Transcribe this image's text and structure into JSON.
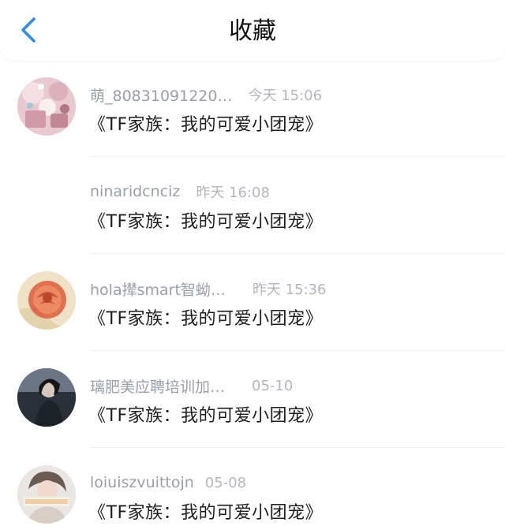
{
  "header": {
    "title": "收藏",
    "back_icon": "chevron-left-icon",
    "accent": "#2f8be8"
  },
  "items": [
    {
      "name": "萌_80831091220…",
      "time": "今天 15:06",
      "book": "《TF家族：我的可爱小团宠》",
      "avatar": "pink-floral-avatar"
    },
    {
      "name": "ninaridcnciz",
      "time": "昨天 16:08",
      "book": "《TF家族：我的可爱小团宠》",
      "avatar": ""
    },
    {
      "name": "hola撵smart智蚴…",
      "time": "昨天 15:36",
      "book": "《TF家族：我的可爱小团宠》",
      "avatar": "rose-avatar"
    },
    {
      "name": "璃肥美应聘培训加…",
      "time": "05-10",
      "book": "《TF家族：我的可爱小团宠》",
      "avatar": "dark-portrait-avatar"
    },
    {
      "name": "loiuiszvuittojn",
      "time": "05-08",
      "book": "《TF家族：我的可爱小团宠》",
      "avatar": "girl-portrait-avatar"
    }
  ]
}
